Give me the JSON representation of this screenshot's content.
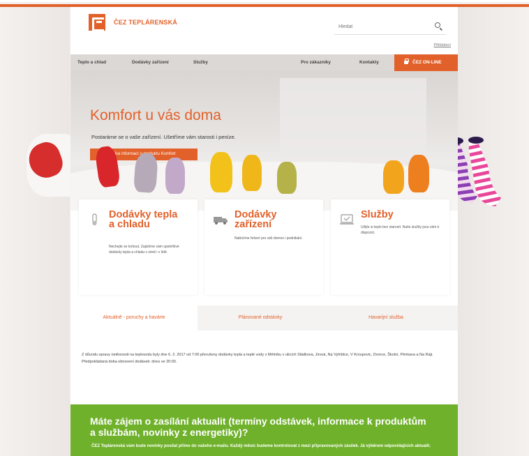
{
  "brand": {
    "name": "ČEZ TEPLÁRENSKÁ",
    "accent_color": "#e2612a",
    "logo_icon": "cez-logo-icon"
  },
  "search": {
    "placeholder": "Hledat",
    "icon": "search-icon"
  },
  "header": {
    "login_link": "Přihlášení"
  },
  "nav": {
    "items": [
      "Teplo a chlad",
      "Dodávky zařízení",
      "Služby",
      "Pro zákazníky",
      "Kontakty"
    ],
    "online": {
      "label": "ČEZ ON-LINE",
      "icon": "lock-icon"
    }
  },
  "hero": {
    "title": "Komfort u vás doma",
    "subtitle": "Postaráme se o vaše zařízení. Ušetříme vám starosti i peníze.",
    "button_label": "Více informací o produktu Komfort"
  },
  "cards": [
    {
      "title": "Dodávky tepla a chladu",
      "text": "Nechejte se torkout. Zajistíme vám spolehlivé dodávky tepla a chladu v zimě i v létě.",
      "icon": "thermometer-icon"
    },
    {
      "title": "Dodávky zařízení",
      "text": "Nabízíme řešení pro váš domov i podnikání.",
      "icon": "truck-icon"
    },
    {
      "title": "Služby",
      "text": "Užijte si teplo bez starostí. Naše služby jsou vám k dispozici.",
      "icon": "service-icon"
    }
  ],
  "tabs": {
    "items": [
      "Aktuálně - poruchy a havárie",
      "Plánované odstávky",
      "Havarijní služba"
    ],
    "active_index": 0
  },
  "outage_notice": "Z důvodu opravy netěsnosti na teplovodu byly dne 6. 2. 2017 od 7:00 přerušeny dodávky tepla a teplé vody v Mělníku v ulicích Sládkova, Jirová, Na Vyhlídce, V Kroupovic, Dvorce, Školní, Pěnkava a Na Ráji. Předpokládaná doba obnovení dodávek: dnes ve 20:00.",
  "newsletter": {
    "title": "Máte zájem o zasílání aktualit (termíny odstávek, informace k produktům a službám, novinky z energetiky)?",
    "text": "ČEZ Teplárenská vám bude novinky posílat přímo do vašeho e-mailu. Každý měsíc budeme kontrolovat z mezi připravovaných zásilek. Já výběrem odpovídajících aktualit."
  }
}
